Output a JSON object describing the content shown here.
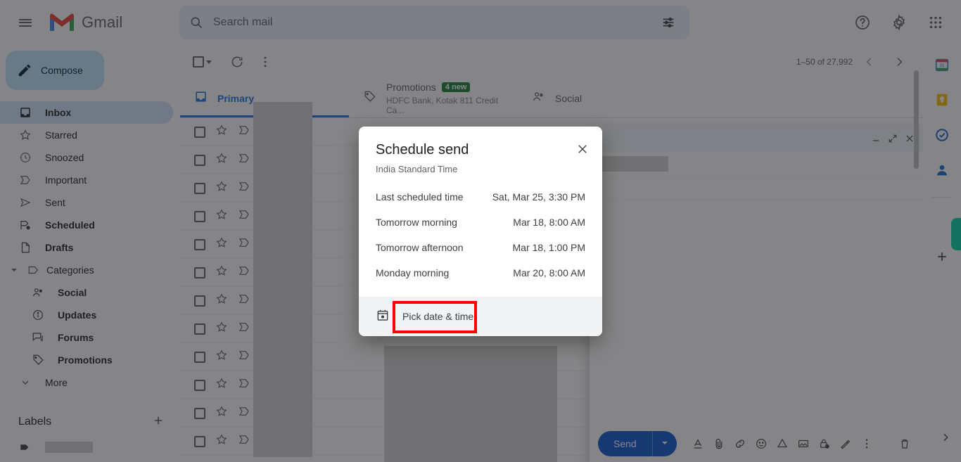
{
  "app": {
    "brand": "Gmail",
    "accent": "#1a73e8",
    "highlight_color": "#ff0000"
  },
  "header": {
    "menu_icon": "hamburger-icon",
    "logo_icon": "gmail-logo-icon",
    "search": {
      "icon": "search-icon",
      "placeholder": "Search mail",
      "value": "",
      "options_icon": "search-options-icon"
    },
    "right_icons": [
      {
        "name": "help-icon",
        "label": "?"
      },
      {
        "name": "settings-icon",
        "label": "gear"
      },
      {
        "name": "apps-grid-icon",
        "label": "apps"
      }
    ]
  },
  "sidebar": {
    "compose": {
      "label": "Compose",
      "icon": "pencil-icon"
    },
    "items": [
      {
        "label": "Inbox",
        "icon": "inbox-icon",
        "active": true,
        "bold": true
      },
      {
        "label": "Starred",
        "icon": "star-icon",
        "active": false,
        "bold": false
      },
      {
        "label": "Snoozed",
        "icon": "clock-icon",
        "active": false,
        "bold": false
      },
      {
        "label": "Important",
        "icon": "important-chevron-icon",
        "active": false,
        "bold": false
      },
      {
        "label": "Sent",
        "icon": "send-arrow-icon",
        "active": false,
        "bold": false
      },
      {
        "label": "Scheduled",
        "icon": "scheduled-icon",
        "active": false,
        "bold": true
      },
      {
        "label": "Drafts",
        "icon": "draft-page-icon",
        "active": false,
        "bold": true
      }
    ],
    "categories": {
      "label": "Categories",
      "icon": "label-tag-icon",
      "expand_icon": "caret-down-icon"
    },
    "subitems": [
      {
        "label": "Social",
        "icon": "people-icon"
      },
      {
        "label": "Updates",
        "icon": "info-circle-icon"
      },
      {
        "label": "Forums",
        "icon": "forums-icon"
      },
      {
        "label": "Promotions",
        "icon": "tag-icon"
      }
    ],
    "more": {
      "label": "More",
      "icon": "chevron-down-icon"
    },
    "labels_header": {
      "title": "Labels",
      "add_icon": "plus-icon"
    },
    "label_rows": [
      {
        "icon": "label-solid-icon",
        "redacted": true
      }
    ]
  },
  "list_toolbar": {
    "select_all_icon": "checkbox-icon",
    "select_caret_icon": "caret-down-icon",
    "refresh_icon": "refresh-icon",
    "more_icon": "more-vertical-icon",
    "page_count": "1–50 of 27,992",
    "prev_icon": "chevron-left-icon",
    "next_icon": "chevron-right-icon"
  },
  "tabs": [
    {
      "label": "Primary",
      "icon": "inbox-tab-icon",
      "active": true,
      "badge": "",
      "subtitle": ""
    },
    {
      "label": "Promotions",
      "icon": "tag-tab-icon",
      "active": false,
      "badge": "4 new",
      "subtitle": "HDFC Bank, Kotak 811 Credit Ca..."
    },
    {
      "label": "Social",
      "icon": "people-tab-icon",
      "active": false,
      "badge": "",
      "subtitle": ""
    }
  ],
  "mail_rows": {
    "count": 12,
    "checkbox_icon": "checkbox-icon",
    "star_icon": "star-outline-icon",
    "important_icon": "important-marker-icon"
  },
  "compose_window": {
    "minimize_icon": "minimize-icon",
    "expand_icon": "expand-icon",
    "close_icon": "close-icon",
    "send": {
      "label": "Send",
      "caret_icon": "caret-down-icon",
      "color": "#0b57d0"
    },
    "tools": [
      {
        "name": "format-text-icon",
        "label": "A"
      },
      {
        "name": "attach-file-icon",
        "label": "paperclip"
      },
      {
        "name": "insert-link-icon",
        "label": "link"
      },
      {
        "name": "insert-emoji-icon",
        "label": "emoji"
      },
      {
        "name": "insert-drive-icon",
        "label": "drive"
      },
      {
        "name": "insert-photo-icon",
        "label": "photo"
      },
      {
        "name": "confidential-mode-icon",
        "label": "lock-clock"
      },
      {
        "name": "insert-signature-icon",
        "label": "pen"
      },
      {
        "name": "more-options-icon",
        "label": "kebab"
      }
    ],
    "discard_icon": "trash-icon"
  },
  "right_rail": {
    "icons": [
      {
        "name": "google-calendar-icon"
      },
      {
        "name": "google-keep-icon"
      },
      {
        "name": "google-tasks-icon"
      },
      {
        "name": "google-contacts-icon"
      }
    ],
    "add_icon": "plus-icon",
    "expand_icon": "chevron-right-icon"
  },
  "dialog": {
    "title": "Schedule send",
    "subtitle": "India Standard Time",
    "close_icon": "close-icon",
    "options": [
      {
        "name": "Last scheduled time",
        "time": "Sat, Mar 25, 3:30 PM"
      },
      {
        "name": "Tomorrow morning",
        "time": "Mar 18, 8:00 AM"
      },
      {
        "name": "Tomorrow afternoon",
        "time": "Mar 18, 1:00 PM"
      },
      {
        "name": "Monday morning",
        "time": "Mar 20, 8:00 AM"
      }
    ],
    "footer": {
      "icon": "calendar-icon",
      "label": "Pick date & time",
      "highlighted": true
    }
  }
}
